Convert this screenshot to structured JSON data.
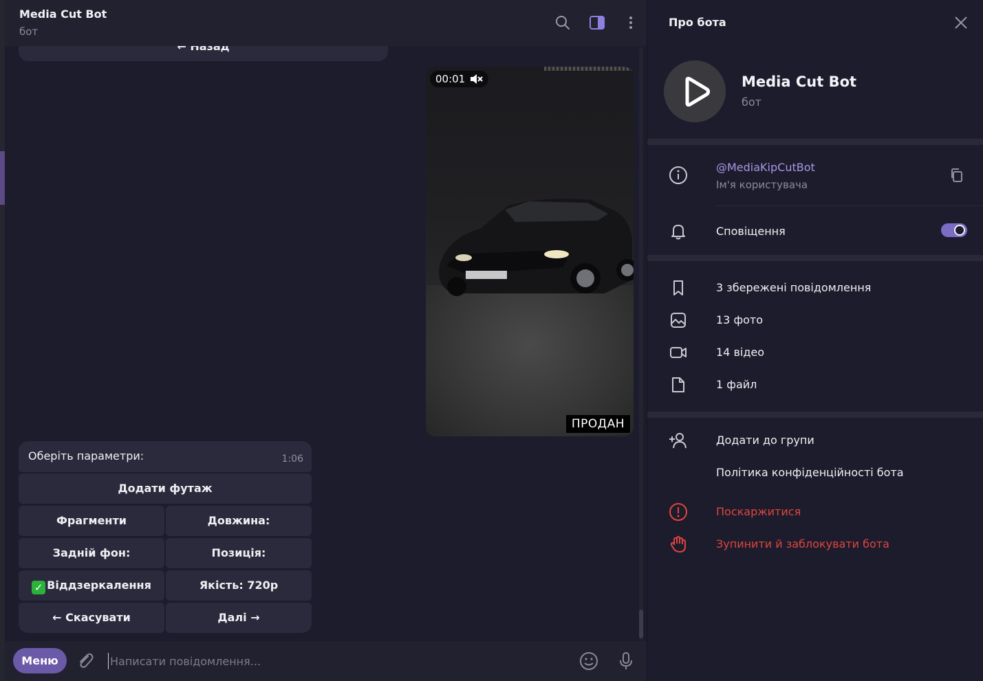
{
  "chat": {
    "title": "Media Cut Bot",
    "subtitle": "бот",
    "top_button": "← Назад",
    "video": {
      "time": "00:01",
      "badge": "ПРОДАН"
    },
    "message": {
      "text": "Оберіть параметри:",
      "time": "1:06"
    },
    "keyboard": {
      "add_footage": "Додати футаж",
      "fragments": "Фрагменти",
      "length": "Довжина:",
      "background": "Задній фон:",
      "position": "Позиція:",
      "mirroring": "Віддзеркалення",
      "quality": "Якість: 720p",
      "cancel": "← Скасувати",
      "next": "Далі →"
    },
    "input": {
      "menu_label": "Меню",
      "placeholder": "Написати повідомлення..."
    }
  },
  "panel": {
    "title": "Про бота",
    "bot_name": "Media Cut Bot",
    "bot_sub": "бот",
    "username": "@MediaKipCutBot",
    "username_label": "Ім'я користувача",
    "notifications": "Сповіщення",
    "notifications_on": true,
    "saved_messages": "3 збережені повідомлення",
    "photos": "13 фото",
    "videos": "14 відео",
    "files": "1 файл",
    "add_to_group": "Додати до групи",
    "privacy_policy": "Політика конфіденційності бота",
    "report": "Поскаржитися",
    "block": "Зупинити й заблокувати бота"
  },
  "colors": {
    "accent": "#7d6cc4",
    "link": "#a896e6",
    "danger": "#e0453f",
    "background": "#1d1c2c"
  },
  "icons": [
    "search-icon",
    "sidebar-toggle-icon",
    "more-vertical-icon",
    "mute-icon",
    "attach-icon",
    "emoji-icon",
    "microphone-icon",
    "close-icon",
    "play-icon",
    "info-icon",
    "copy-icon",
    "bell-icon",
    "bookmark-icon",
    "photo-icon",
    "video-icon",
    "file-icon",
    "add-user-icon",
    "report-icon",
    "stop-hand-icon"
  ]
}
